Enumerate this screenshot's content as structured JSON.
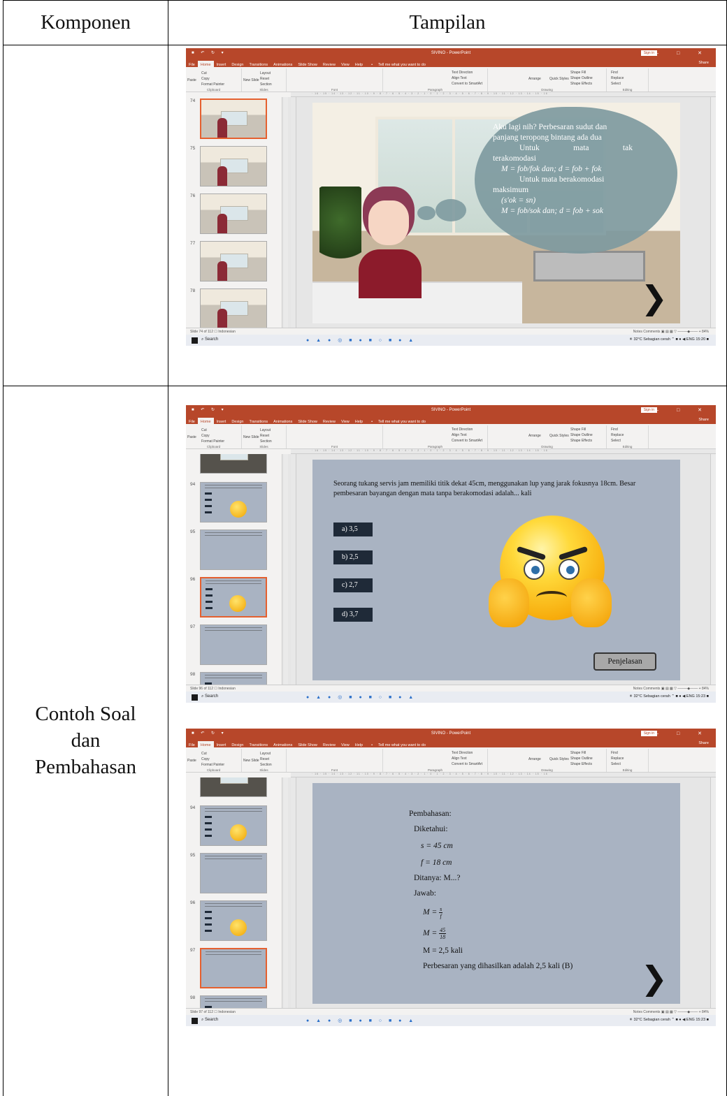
{
  "table": {
    "headers": [
      "Komponen",
      "Tampilan"
    ],
    "row2_label": "Contoh Soal\ndan\nPembahasan"
  },
  "ppt": {
    "title": "SIVINO - PowerPoint",
    "sign_in": "Sign in",
    "share": "Share",
    "tell_me": "Tell me what you want to do",
    "tabs": [
      "File",
      "Home",
      "Insert",
      "Design",
      "Transitions",
      "Animations",
      "Slide Show",
      "Review",
      "View",
      "Help"
    ],
    "ribbon": {
      "clipboard": "Clipboard",
      "slides": "Slides",
      "font": "Font",
      "paragraph": "Paragraph",
      "drawing": "Drawing",
      "editing": "Editing",
      "paste": "Paste",
      "cut": "Cut",
      "copy": "Copy",
      "format_painter": "Format Painter",
      "new_slide": "New Slide",
      "layout": "Layout",
      "reset": "Reset",
      "section": "Section",
      "text_direction": "Text Direction",
      "align_text": "Align Text",
      "convert_smartart": "Convert to SmartArt",
      "arrange": "Arrange",
      "quick_styles": "Quick Styles",
      "shape_fill": "Shape Fill",
      "shape_outline": "Shape Outline",
      "shape_effects": "Shape Effects",
      "find": "Find",
      "replace": "Replace",
      "select": "Select"
    },
    "status": {
      "language": "Indonesian",
      "notes": "Notes",
      "comments": "Comments",
      "zoom": "84%"
    },
    "taskbar": {
      "search": "Search",
      "weather": "32°C Sebagian cerah",
      "lang": "ENG"
    }
  },
  "screens": [
    {
      "slide_status": "Slide 74 of 112",
      "time": "15:20",
      "thumb_numbers": [
        "74",
        "75",
        "76",
        "77",
        "78"
      ],
      "selected_index": 0,
      "cloud_lines": {
        "l1": "Aku lagi nih? Perbesaran sudut dan",
        "l2": "panjang teropong bintang ada dua",
        "l3a": "Untuk",
        "l3b": "mata",
        "l3c": "tak",
        "l4": "terakomodasi",
        "f1": "M = fob/fok dan; d = fob + fok",
        "l5": "Untuk mata berakomodasi",
        "l6": "maksimum",
        "f2": "(s'ok = sn)",
        "f3": "M = fob/sok dan; d = fob + sok"
      }
    },
    {
      "slide_status": "Slide 96 of 112",
      "time": "15:23",
      "thumb_numbers": [
        "94",
        "95",
        "96",
        "97",
        "98"
      ],
      "selected_index": 2,
      "question": "Seorang tukang servis jam memiliki titik dekat 45cm, menggunakan lup yang jarak fokusnya 18cm. Besar pembesaran bayangan dengan mata tanpa berakomodasi adalah... kali",
      "options": [
        "a)  3,5",
        "b)  2,5",
        "c)  2,7",
        "d)  3,7"
      ],
      "button": "Penjelasan"
    },
    {
      "slide_status": "Slide 97 of 112",
      "time": "15:23",
      "thumb_numbers": [
        "94",
        "95",
        "96",
        "97",
        "98"
      ],
      "selected_index": 3,
      "solution": {
        "heading": "Pembahasan:",
        "known": "Diketahui:",
        "s": "s = 45 cm",
        "f": "f = 18 cm",
        "asked": "Ditanya: M...?",
        "answer": "Jawab:",
        "m1_left": "M = ",
        "m1_num": "s",
        "m1_den": "f",
        "m2_left": "M = ",
        "m2_num": "45",
        "m2_den": "18",
        "m3": "M = 2,5 kali",
        "conclusion": "Perbesaran yang dihasilkan adalah 2,5 kali (B)"
      }
    }
  ]
}
